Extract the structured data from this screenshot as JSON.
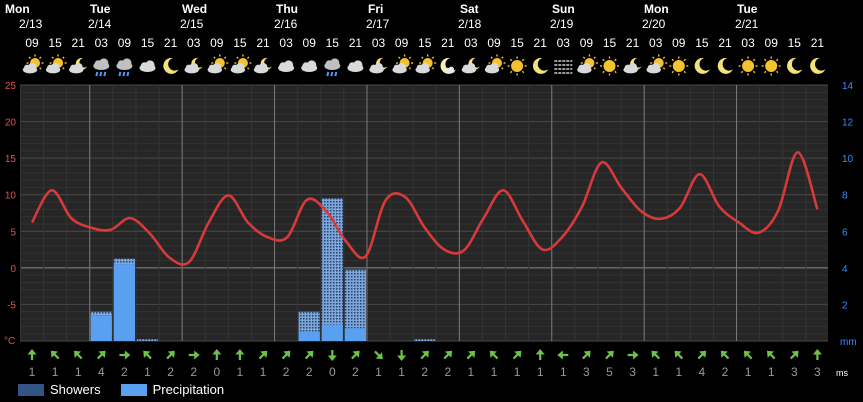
{
  "days": [
    {
      "name": "Mon",
      "date": "2/13"
    },
    {
      "name": "Tue",
      "date": "2/14"
    },
    {
      "name": "Wed",
      "date": "2/15"
    },
    {
      "name": "Thu",
      "date": "2/16"
    },
    {
      "name": "Fri",
      "date": "2/17"
    },
    {
      "name": "Sat",
      "date": "2/18"
    },
    {
      "name": "Sun",
      "date": "2/19"
    },
    {
      "name": "Mon",
      "date": "2/20"
    },
    {
      "name": "Tue",
      "date": "2/21"
    }
  ],
  "hours": [
    "09",
    "15",
    "21",
    "03",
    "09",
    "15",
    "21",
    "03",
    "09",
    "15",
    "21",
    "03",
    "09",
    "15",
    "21",
    "03",
    "09",
    "15",
    "21",
    "03",
    "09",
    "15",
    "21",
    "03",
    "09",
    "15",
    "21",
    "03",
    "09",
    "15",
    "21",
    "03",
    "09",
    "15",
    "21"
  ],
  "icons": [
    "partly-cloudy-day-icon",
    "partly-cloudy-day-icon",
    "partly-cloudy-night-icon",
    "rain-cloud-icon",
    "rain-cloud-icon",
    "cloud-icon",
    "moon-icon",
    "partly-cloudy-night-icon",
    "partly-cloudy-day-icon",
    "partly-cloudy-day-icon",
    "partly-cloudy-night-icon",
    "cloud-icon",
    "cloud-icon",
    "rain-cloud-icon",
    "cloud-icon",
    "partly-cloudy-night-icon",
    "partly-cloudy-day-icon",
    "partly-cloudy-day-icon",
    "moon-cloud-icon",
    "partly-cloudy-night-icon",
    "partly-cloudy-day-icon",
    "sun-icon",
    "moon-icon",
    "fog-icon",
    "partly-cloudy-day-icon",
    "sun-icon",
    "partly-cloudy-night-icon",
    "partly-cloudy-day-icon",
    "sun-icon",
    "moon-icon",
    "moon-icon",
    "sun-icon",
    "sun-icon",
    "moon-icon",
    "moon-icon"
  ],
  "wind": {
    "speeds": [
      "1",
      "1",
      "1",
      "4",
      "2",
      "1",
      "2",
      "2",
      "0",
      "1",
      "1",
      "2",
      "2",
      "0",
      "2",
      "1",
      "1",
      "2",
      "2",
      "1",
      "1",
      "1",
      "1",
      "1",
      "3",
      "5",
      "3",
      "1",
      "1",
      "4",
      "2",
      "1",
      "1",
      "3",
      "3"
    ],
    "directions": [
      0,
      315,
      315,
      45,
      90,
      315,
      45,
      90,
      0,
      0,
      45,
      45,
      45,
      180,
      45,
      135,
      180,
      45,
      45,
      45,
      315,
      45,
      0,
      270,
      45,
      45,
      90,
      315,
      315,
      45,
      315,
      315,
      315,
      45,
      0
    ],
    "unit": "ms"
  },
  "legend": {
    "showers": "Showers",
    "precipitation": "Precipitation"
  },
  "colors": {
    "temp": "#d8393a",
    "precip": "#5aa0f0",
    "showers": "#7fa6d8",
    "left_axis": "#e05050",
    "right_axis": "#3a8cff",
    "wind_arrow": "#6ec14a",
    "wind_text": "#9a9a9a"
  },
  "chart_data": {
    "type": "line",
    "temperature": {
      "unit": "°C",
      "ylim": [
        -10,
        25
      ],
      "yticks": [
        -5,
        0,
        5,
        10,
        15,
        20,
        25
      ],
      "x": [
        0,
        1,
        2,
        3,
        4,
        5,
        6,
        7,
        8,
        9,
        10,
        11,
        12,
        13,
        14,
        15,
        16,
        17,
        18,
        19,
        20,
        21,
        22,
        23,
        24,
        25,
        26,
        27,
        28,
        29,
        30,
        31,
        32,
        33,
        34
      ],
      "values": [
        6.2,
        10.6,
        6.8,
        5.5,
        5.2,
        6.8,
        4.7,
        1.4,
        0.8,
        6.2,
        9.9,
        6.2,
        4.2,
        4.2,
        9.3,
        7.7,
        3.6,
        1.6,
        9.2,
        9.7,
        5.5,
        2.5,
        2.4,
        6.8,
        10.6,
        6.4,
        2.5,
        4.2,
        8.3,
        14.4,
        11.0,
        7.8,
        6.7,
        8.2,
        12.8,
        8.4,
        6.2,
        4.8,
        7.8,
        15.8,
        8.0
      ]
    },
    "precipitation": {
      "unit": "mm",
      "ylim": [
        0,
        14
      ],
      "yticks": [
        2,
        4,
        6,
        8,
        10,
        12,
        14
      ],
      "bars": [
        {
          "x": 3,
          "total": 1.6,
          "precipitation": 1.4
        },
        {
          "x": 4,
          "total": 4.5,
          "precipitation": 4.2
        },
        {
          "x": 5,
          "total": 0.1,
          "precipitation": 0.0
        },
        {
          "x": 12,
          "total": 1.6,
          "precipitation": 0.5
        },
        {
          "x": 13,
          "total": 7.8,
          "precipitation": 0.9
        },
        {
          "x": 14,
          "total": 3.9,
          "precipitation": 0.7
        },
        {
          "x": 17,
          "total": 0.1,
          "precipitation": 0.0
        }
      ]
    }
  }
}
